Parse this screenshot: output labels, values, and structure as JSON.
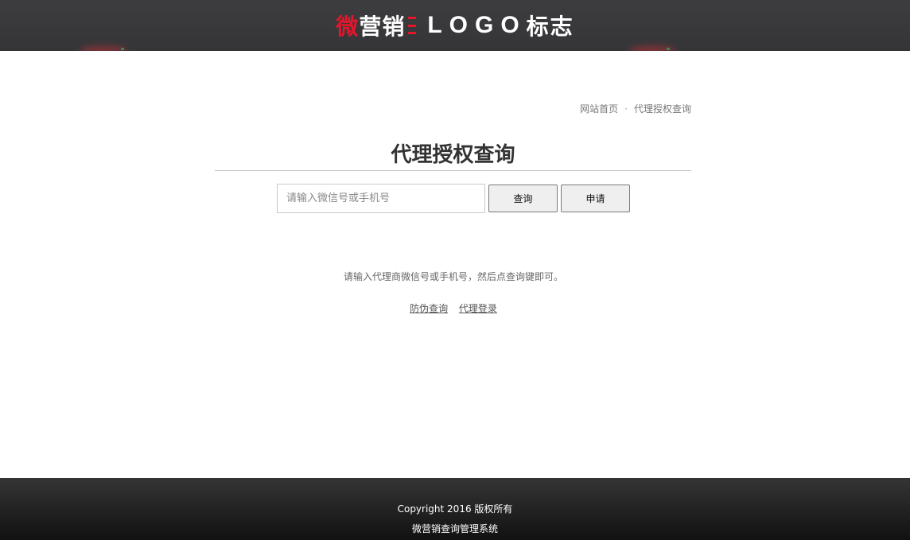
{
  "header": {
    "logo": {
      "wei": "微",
      "yingxiao": "营销",
      "logo_text": "LOGO",
      "biaozhi": "标志"
    },
    "colors": {
      "background": "#3a3a3c",
      "accent": "#e3162c"
    }
  },
  "breadcrumb": {
    "home": "网站首页",
    "separator": "·",
    "current": "代理授权查询"
  },
  "page": {
    "title": "代理授权查询"
  },
  "search": {
    "placeholder": "请输入微信号或手机号",
    "value": "",
    "query_label": "查询",
    "apply_label": "申请"
  },
  "hint": "请输入代理商微信号或手机号，然后点查询键即可。",
  "links": {
    "anti_fake": "防伪查询",
    "agent_login": "代理登录"
  },
  "footer": {
    "copyright": "Copyright 2016 版权所有",
    "system_name": "微营销查询管理系统"
  }
}
